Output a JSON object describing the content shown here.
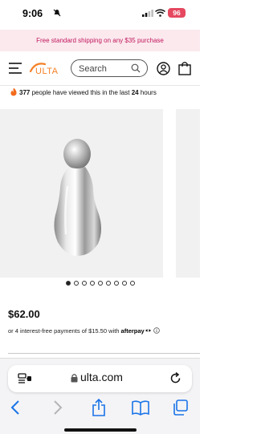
{
  "status_bar": {
    "time": "9:06",
    "battery": "96",
    "battery_color": "#e5485f"
  },
  "promo": {
    "text": "Free standard shipping on any $35 purchase",
    "color": "#c2185b",
    "background": "#fbe9ee"
  },
  "header": {
    "logo_text": "ULTA",
    "search_placeholder": "Search",
    "icons": [
      "menu-icon",
      "search-icon",
      "user-icon",
      "bag-icon"
    ]
  },
  "viewed": {
    "count": "377",
    "text_before": "people have viewed this in the last",
    "hours": "24",
    "text_after": "hours"
  },
  "gallery": {
    "slide_count": 9,
    "active_index": 0
  },
  "product": {
    "price": "$62.00",
    "installment_prefix": "or 4 interest-free payments of",
    "installment_amount": "$15.50",
    "installment_with": "with",
    "installment_provider": "afterpay"
  },
  "browser": {
    "url": "ulta.com",
    "icons": [
      "reader-icon",
      "lock-icon",
      "reload-icon",
      "back-icon",
      "forward-icon",
      "share-icon",
      "bookmarks-icon",
      "tabs-icon"
    ],
    "accent": "#1a73e8"
  }
}
